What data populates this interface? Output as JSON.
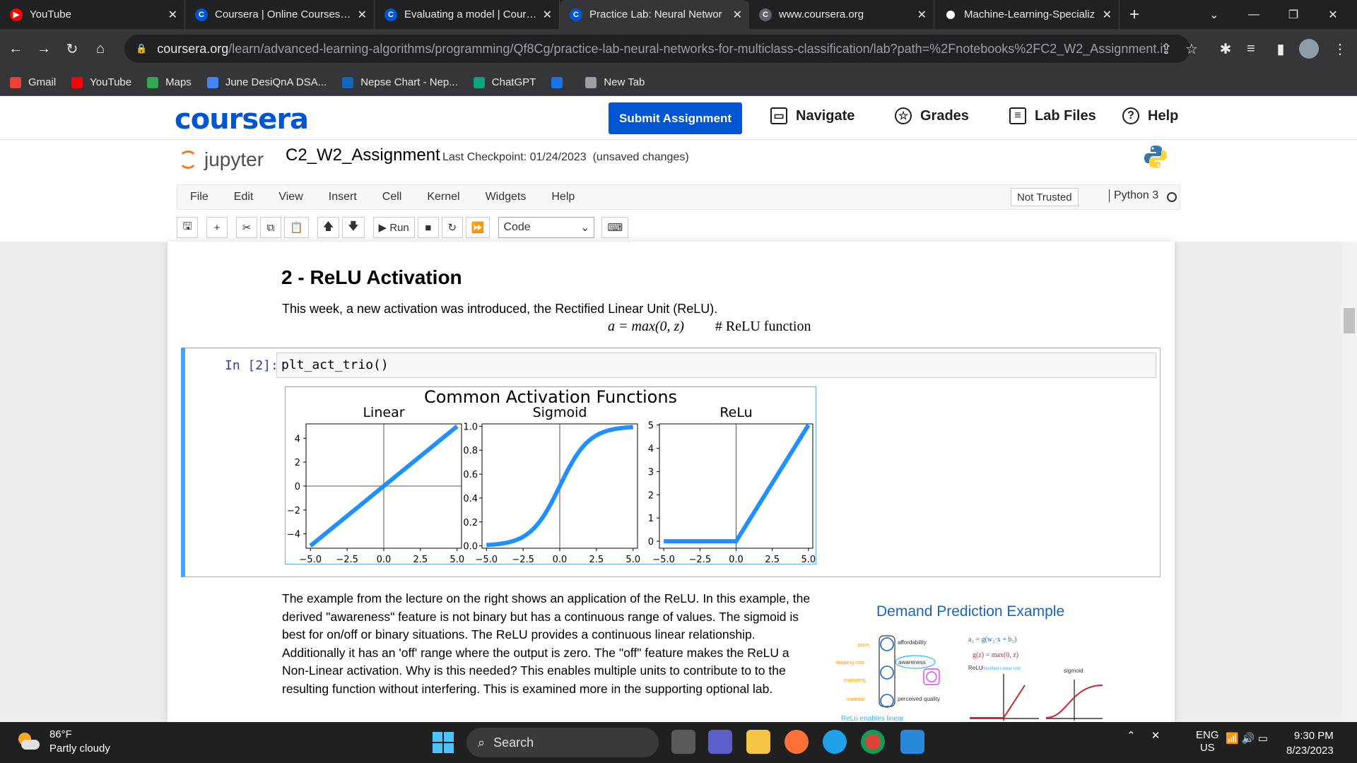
{
  "tabs": [
    {
      "title": "YouTube",
      "icon": "youtube-icon",
      "color": "#ff0000",
      "active": false
    },
    {
      "title": "Coursera | Online Courses & Cr",
      "icon": "coursera-icon",
      "color": "#0056d2",
      "active": false
    },
    {
      "title": "Evaluating a model | Coursera",
      "icon": "coursera-icon",
      "color": "#0056d2",
      "active": false
    },
    {
      "title": "Practice Lab: Neural Networ",
      "icon": "coursera-icon",
      "color": "#0056d2",
      "active": true
    },
    {
      "title": "www.coursera.org",
      "icon": "coursera-icon",
      "color": "#5f6368",
      "active": false
    },
    {
      "title": "Machine-Learning-Specializ",
      "icon": "github-icon",
      "color": "#ffffff",
      "active": false
    }
  ],
  "address": {
    "host": "coursera.org",
    "path": "/learn/advanced-learning-algorithms/programming/Qf8Cg/practice-lab-neural-networks-for-multiclass-classification/lab?path=%2Fnotebooks%2FC2_W2_Assignment.i..."
  },
  "bookmarks": [
    {
      "label": "Gmail",
      "icon": "gmail-icon",
      "color": "#ea4335"
    },
    {
      "label": "YouTube",
      "icon": "youtube-icon",
      "color": "#ff0000"
    },
    {
      "label": "Maps",
      "icon": "maps-icon",
      "color": "#34a853"
    },
    {
      "label": "June DesiQnA DSA...",
      "icon": "docs-icon",
      "color": "#4285f4"
    },
    {
      "label": "Nepse Chart - Nep...",
      "icon": "chart-icon",
      "color": "#1565c0"
    },
    {
      "label": "ChatGPT",
      "icon": "chatgpt-icon",
      "color": "#10a37f"
    },
    {
      "label": "",
      "icon": "bookmark-icon",
      "color": "#1a73e8"
    },
    {
      "label": "New Tab",
      "icon": "globe-icon",
      "color": "#9aa0a6"
    }
  ],
  "coursera": {
    "logo": "coursera",
    "submit": "Submit Assignment",
    "navigate": "Navigate",
    "grades": "Grades",
    "lab_files": "Lab Files",
    "help": "Help"
  },
  "jupyter": {
    "brand": "jupyter",
    "notebook": "C2_W2_Assignment",
    "checkpoint": "Last Checkpoint: 01/24/2023",
    "status": "(unsaved changes)",
    "menus": [
      "File",
      "Edit",
      "View",
      "Insert",
      "Cell",
      "Kernel",
      "Widgets",
      "Help"
    ],
    "trust": "Not Trusted",
    "kernel": "Python 3",
    "run": "Run",
    "cell_type": "Code"
  },
  "notebook": {
    "heading": "2 - ReLU Activation",
    "intro": "This week, a new activation was introduced, the Rectified Linear Unit (ReLU).",
    "formula": "a = max(0, z)",
    "formula_comment": "# ReLU function",
    "prompt": "In [2]:",
    "code": "plt_act_trio()",
    "paragraph": "The example from the lecture on the right shows an application of the ReLU. In this example, the derived \"awareness\" feature is not binary but has a continuous range of values. The sigmoid is best for on/off or binary situations. The ReLU provides a continuous linear relationship. Additionally it has an 'off' range where the output is zero. The \"off\" feature makes the ReLU a Non-Linear activation. Why is this needed? This enables multiple units to contribute to to the resulting function without interfering. This is examined more in the supporting optional lab."
  },
  "demand_figure": {
    "title": "Demand Prediction Example",
    "left_inputs": [
      "price",
      "shipping cost",
      "marketing",
      "material"
    ],
    "nodes": [
      "affordability",
      "awareness",
      "perceived quality"
    ],
    "relu_formula": "g(z) = max(0, z)",
    "relu_label": "ReLU",
    "relu_note": "Rectified Linear Unit",
    "sigmoid_label": "sigmoid",
    "footer": "ReLu enables linear"
  },
  "chart_data": [
    {
      "type": "line",
      "suptitle": "Common Activation Functions",
      "title": "Linear",
      "x": [
        -5,
        5
      ],
      "y": [
        -5,
        5
      ],
      "xlim": [
        -5.3,
        5.3
      ],
      "ylim": [
        -5.2,
        5.2
      ],
      "xticks": [
        "−5.0",
        "−2.5",
        "0.0",
        "2.5",
        "5.0"
      ],
      "xtick_values": [
        -5,
        -2.5,
        0,
        2.5,
        5
      ],
      "yticks": [
        "−4",
        "−2",
        "0",
        "2",
        "4"
      ],
      "ytick_values": [
        -4,
        -2,
        0,
        2,
        4
      ],
      "color": "#1e90ff"
    },
    {
      "type": "line",
      "title": "Sigmoid",
      "function": "sigmoid",
      "xlim": [
        -5.3,
        5.3
      ],
      "ylim": [
        -0.02,
        1.02
      ],
      "xticks": [
        "−5.0",
        "−2.5",
        "0.0",
        "2.5",
        "5.0"
      ],
      "xtick_values": [
        -5,
        -2.5,
        0,
        2.5,
        5
      ],
      "yticks": [
        "0.0",
        "0.2",
        "0.4",
        "0.6",
        "0.8",
        "1.0"
      ],
      "ytick_values": [
        0,
        0.2,
        0.4,
        0.6,
        0.8,
        1
      ],
      "color": "#1e90ff"
    },
    {
      "type": "line",
      "title": "ReLu",
      "x": [
        -5,
        0,
        5
      ],
      "y": [
        0,
        0,
        5
      ],
      "xlim": [
        -5.3,
        5.3
      ],
      "ylim": [
        -0.3,
        5.05
      ],
      "xticks": [
        "−5.0",
        "−2.5",
        "0.0",
        "2.5",
        "5.0"
      ],
      "xtick_values": [
        -5,
        -2.5,
        0,
        2.5,
        5
      ],
      "yticks": [
        "0",
        "1",
        "2",
        "3",
        "4",
        "5"
      ],
      "ytick_values": [
        0,
        1,
        2,
        3,
        4,
        5
      ],
      "color": "#1e90ff"
    }
  ],
  "taskbar": {
    "temp": "86°F",
    "weather": "Partly cloudy",
    "search": "Search",
    "lang": "ENG",
    "region": "US",
    "time": "9:30 PM",
    "date": "8/23/2023"
  }
}
